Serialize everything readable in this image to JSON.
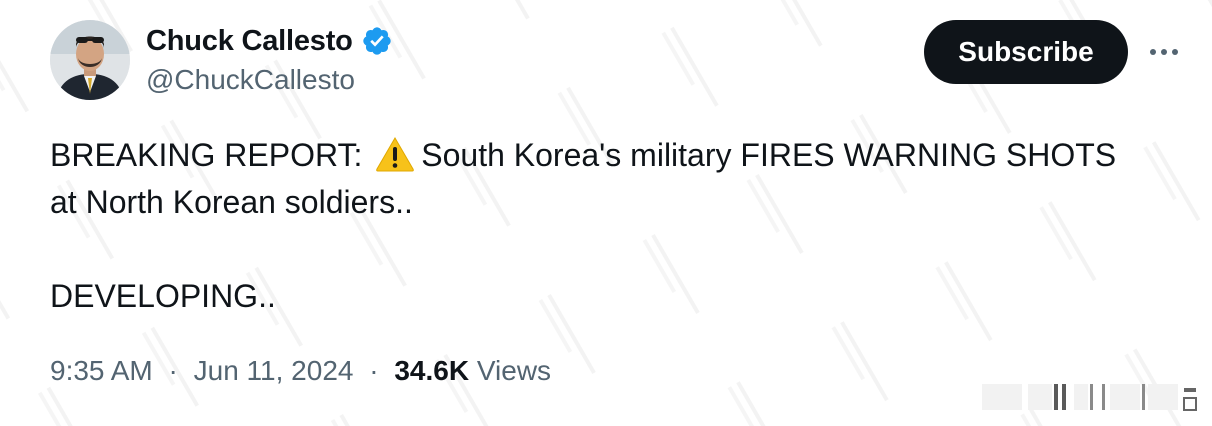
{
  "author": {
    "display_name": "Chuck Callesto",
    "handle": "@ChuckCallesto",
    "verified": true,
    "verified_color": "#1d9bf0"
  },
  "actions": {
    "subscribe_label": "Subscribe",
    "more_icon": "more-horizontal-icon"
  },
  "tweet": {
    "line1_prefix": "BREAKING REPORT:",
    "line1_icon": "warning-icon",
    "line1_suffix": "South Korea's military FIRES WARNING SHOTS",
    "line2": "at North Korean soldiers..",
    "line3": "DEVELOPING.."
  },
  "meta": {
    "time": "9:35 AM",
    "date": "Jun 11, 2024",
    "separator": "·",
    "views_count": "34.6K",
    "views_label": "Views"
  },
  "colors": {
    "text_primary": "#0f1419",
    "text_secondary": "#536471",
    "button_bg": "#0f1419",
    "button_text": "#ffffff"
  }
}
